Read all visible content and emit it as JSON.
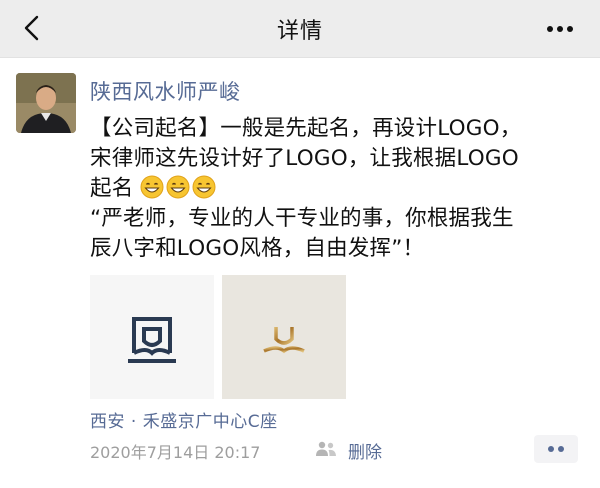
{
  "navbar": {
    "title": "详情",
    "back_icon": "chevron-left-icon",
    "more_icon": "more-dots-icon"
  },
  "post": {
    "author": "陕西风水师严峻",
    "content_lines": [
      "【公司起名】一般是先起名，再设计LOGO，",
      "宋律师这先设计好了LOGO，让我根据LOGO",
      "起名",
      "“严老师，专业的人干专业的事，你根据我生",
      "辰八字和LOGO风格，自由发挥”！"
    ],
    "emojis": [
      "grinning-face-emoji",
      "grinning-face-emoji",
      "grinning-face-emoji"
    ],
    "photos": [
      "logo-image-navy",
      "logo-image-gold"
    ],
    "location": "西安 · 禾盛京广中心C座",
    "timestamp": "2020年7月14日 20:17",
    "visibility_icon": "friends-group-icon",
    "delete_label": "删除",
    "comment_icon": "comment-dots-icon"
  },
  "colors": {
    "link": "#576b95",
    "navbar_bg": "#ededed",
    "meta_gray": "#9e9e9e",
    "logo_navy": "#2a3a52",
    "logo_gold": "#b88a3e"
  }
}
